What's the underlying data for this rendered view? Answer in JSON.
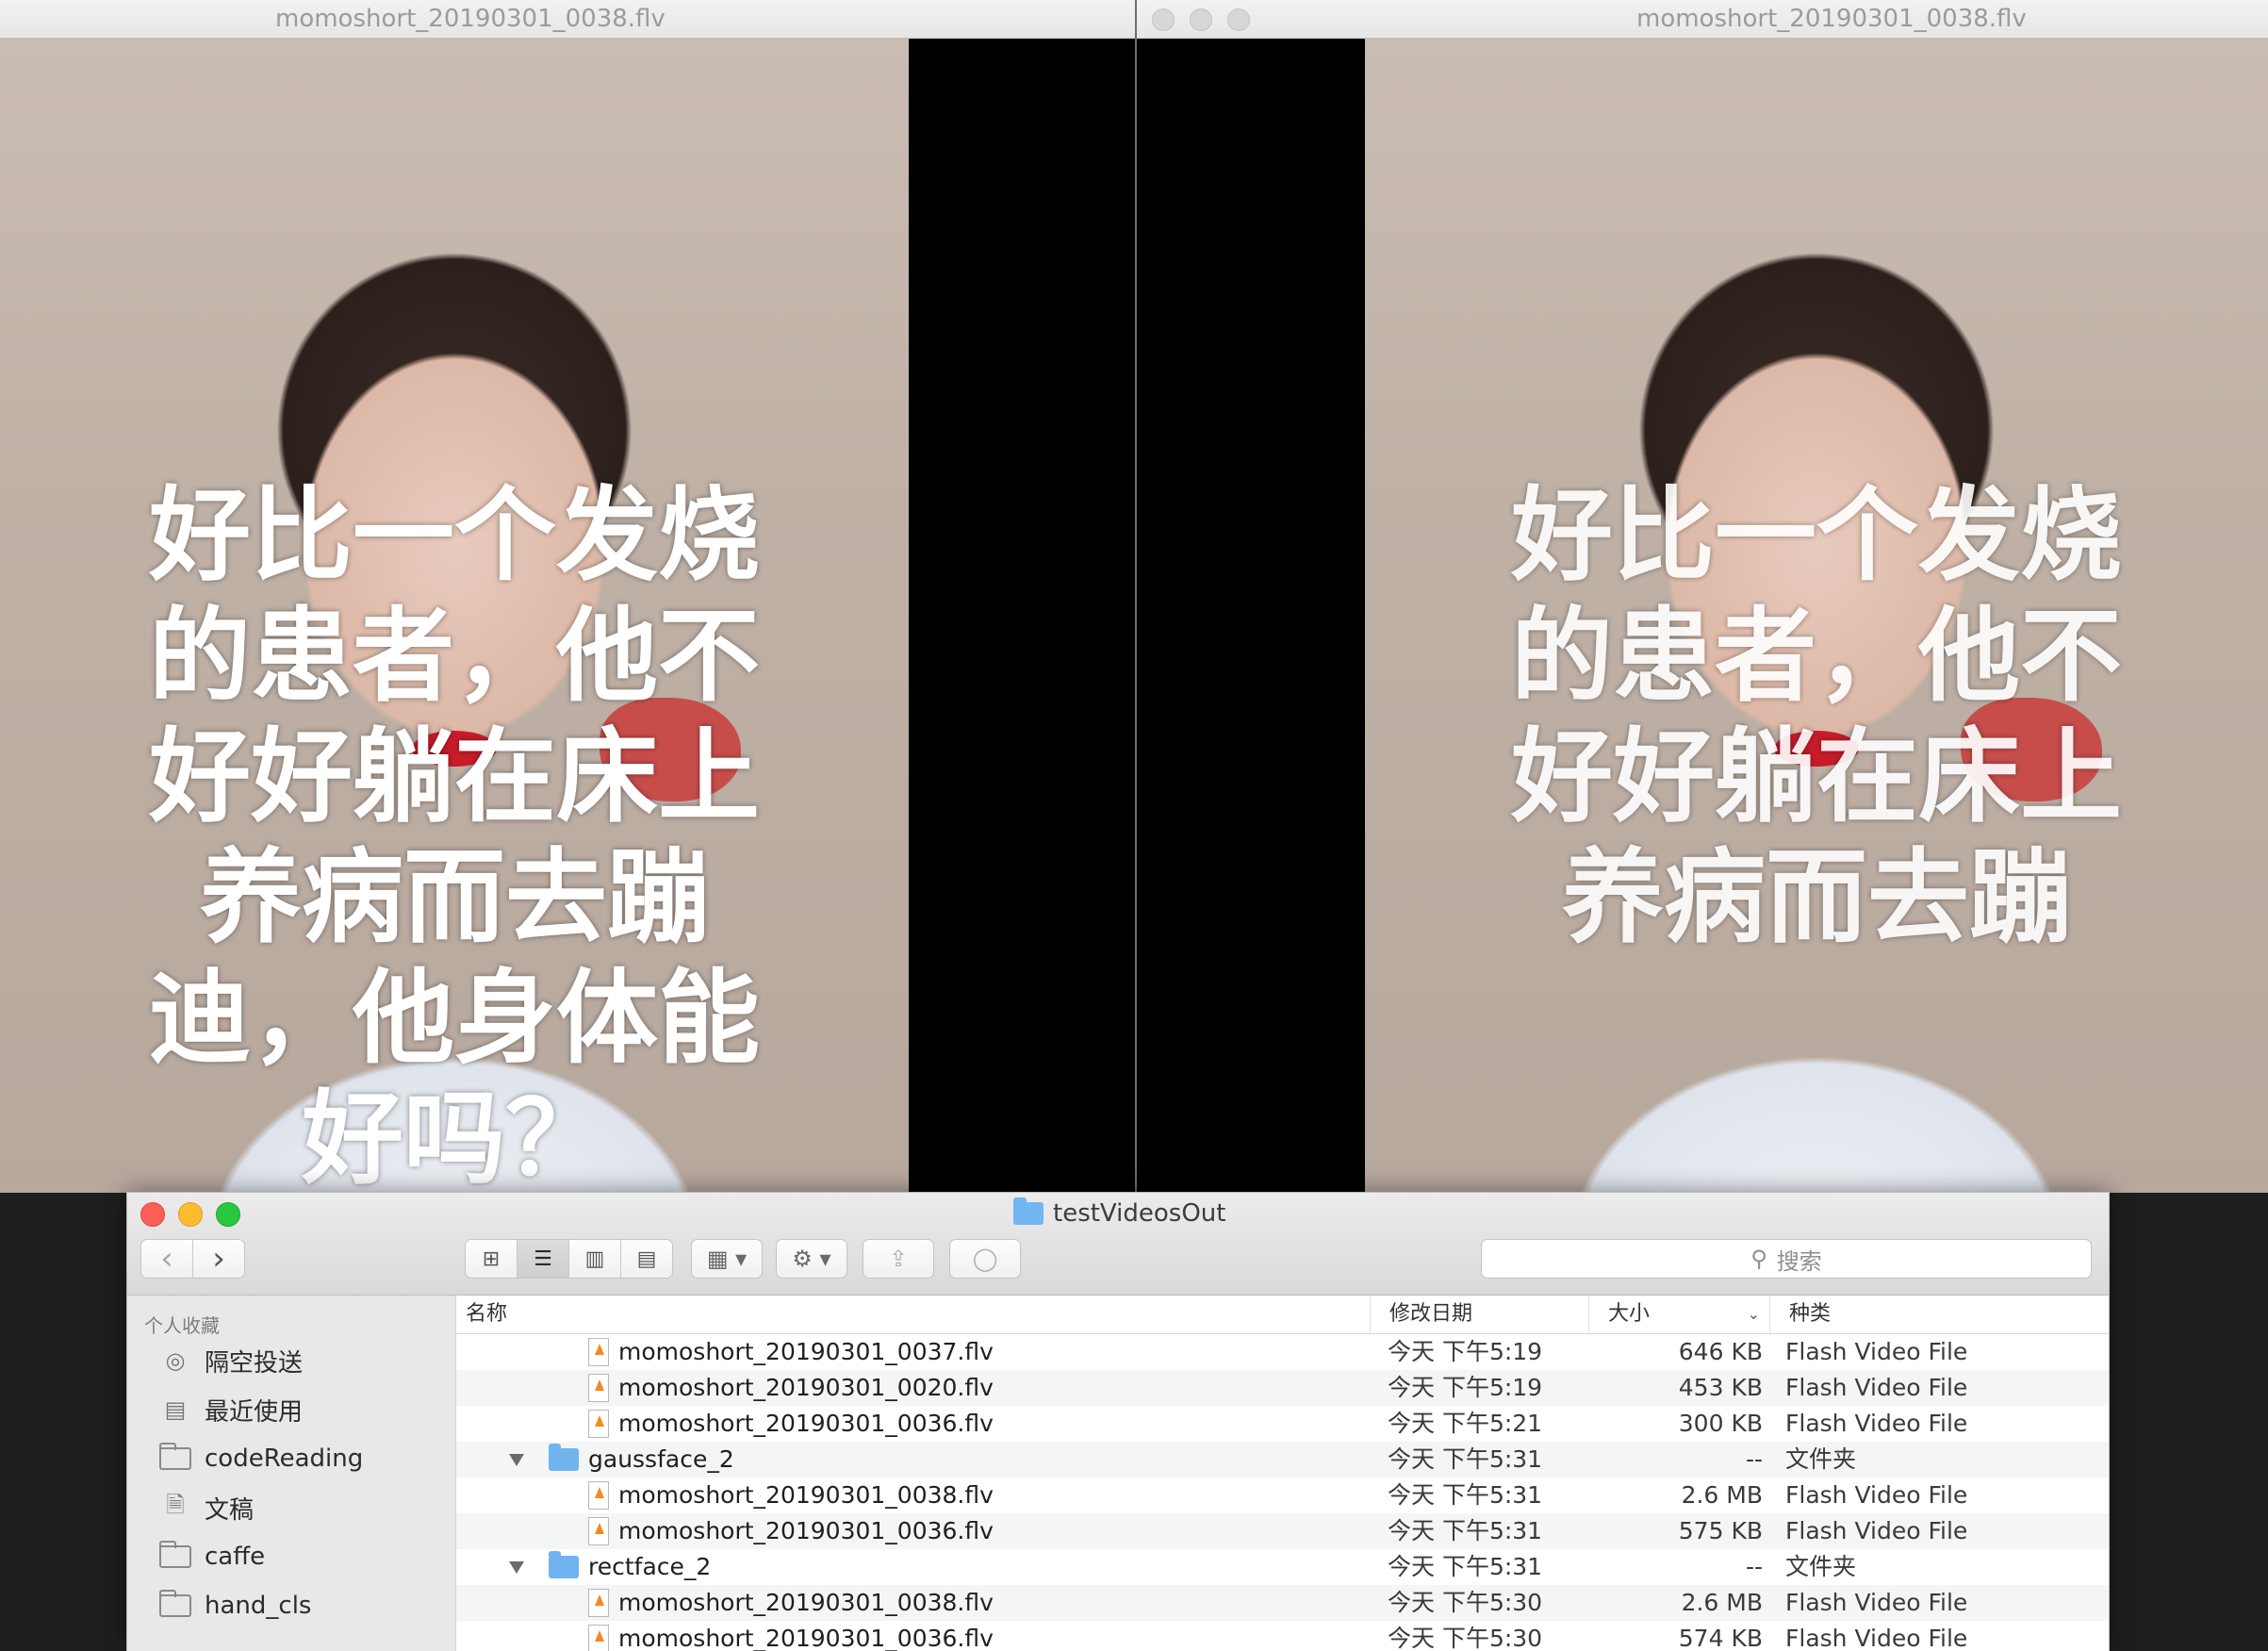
{
  "players": [
    {
      "title": "momoshort_20190301_0038.flv",
      "subtitle_lines": [
        "好比一个发烧",
        "的患者，他不",
        "好好躺在床上",
        "养病而去蹦",
        "迪，他身体能",
        "好吗？"
      ]
    },
    {
      "title": "momoshort_20190301_0038.flv",
      "subtitle_lines": [
        "好比一个发烧",
        "的患者，他不",
        "好好躺在床上",
        "养病而去蹦"
      ]
    }
  ],
  "finder": {
    "title": "testVideosOut",
    "search_placeholder": "搜索",
    "toolbar": {
      "back_icon": "‹",
      "forward_icon": "›",
      "view_icons": [
        "⊞",
        "☰",
        "▥",
        "▤"
      ],
      "group_icon": "▦ ▾",
      "action_icon": "⚙ ▾",
      "share_icon": "⇪",
      "tag_icon": "◯"
    },
    "sidebar": {
      "header": "个人收藏",
      "items": [
        {
          "label": "隔空投送",
          "icon": "airdrop-icon"
        },
        {
          "label": "最近使用",
          "icon": "recents-icon"
        },
        {
          "label": "codeReading",
          "icon": "folder-icon"
        },
        {
          "label": "文稿",
          "icon": "documents-icon"
        },
        {
          "label": "caffe",
          "icon": "folder-icon"
        },
        {
          "label": "hand_cls",
          "icon": "folder-icon"
        }
      ]
    },
    "columns": {
      "name": "名称",
      "date": "修改日期",
      "size": "大小",
      "kind": "种类"
    },
    "rows": [
      {
        "name": "momoshort_20190301_0037.flv",
        "date": "今天 下午5:19",
        "size": "646 KB",
        "kind": "Flash Video File",
        "type": "file"
      },
      {
        "name": "momoshort_20190301_0020.flv",
        "date": "今天 下午5:19",
        "size": "453 KB",
        "kind": "Flash Video File",
        "type": "file"
      },
      {
        "name": "momoshort_20190301_0036.flv",
        "date": "今天 下午5:21",
        "size": "300 KB",
        "kind": "Flash Video File",
        "type": "file"
      },
      {
        "name": "gaussface_2",
        "date": "今天 下午5:31",
        "size": "--",
        "kind": "文件夹",
        "type": "folder"
      },
      {
        "name": "momoshort_20190301_0038.flv",
        "date": "今天 下午5:31",
        "size": "2.6 MB",
        "kind": "Flash Video File",
        "type": "file"
      },
      {
        "name": "momoshort_20190301_0036.flv",
        "date": "今天 下午5:31",
        "size": "575 KB",
        "kind": "Flash Video File",
        "type": "file"
      },
      {
        "name": "rectface_2",
        "date": "今天 下午5:31",
        "size": "--",
        "kind": "文件夹",
        "type": "folder"
      },
      {
        "name": "momoshort_20190301_0038.flv",
        "date": "今天 下午5:30",
        "size": "2.6 MB",
        "kind": "Flash Video File",
        "type": "file"
      },
      {
        "name": "momoshort_20190301_0036.flv",
        "date": "今天 下午5:30",
        "size": "574 KB",
        "kind": "Flash Video File",
        "type": "file"
      }
    ]
  }
}
